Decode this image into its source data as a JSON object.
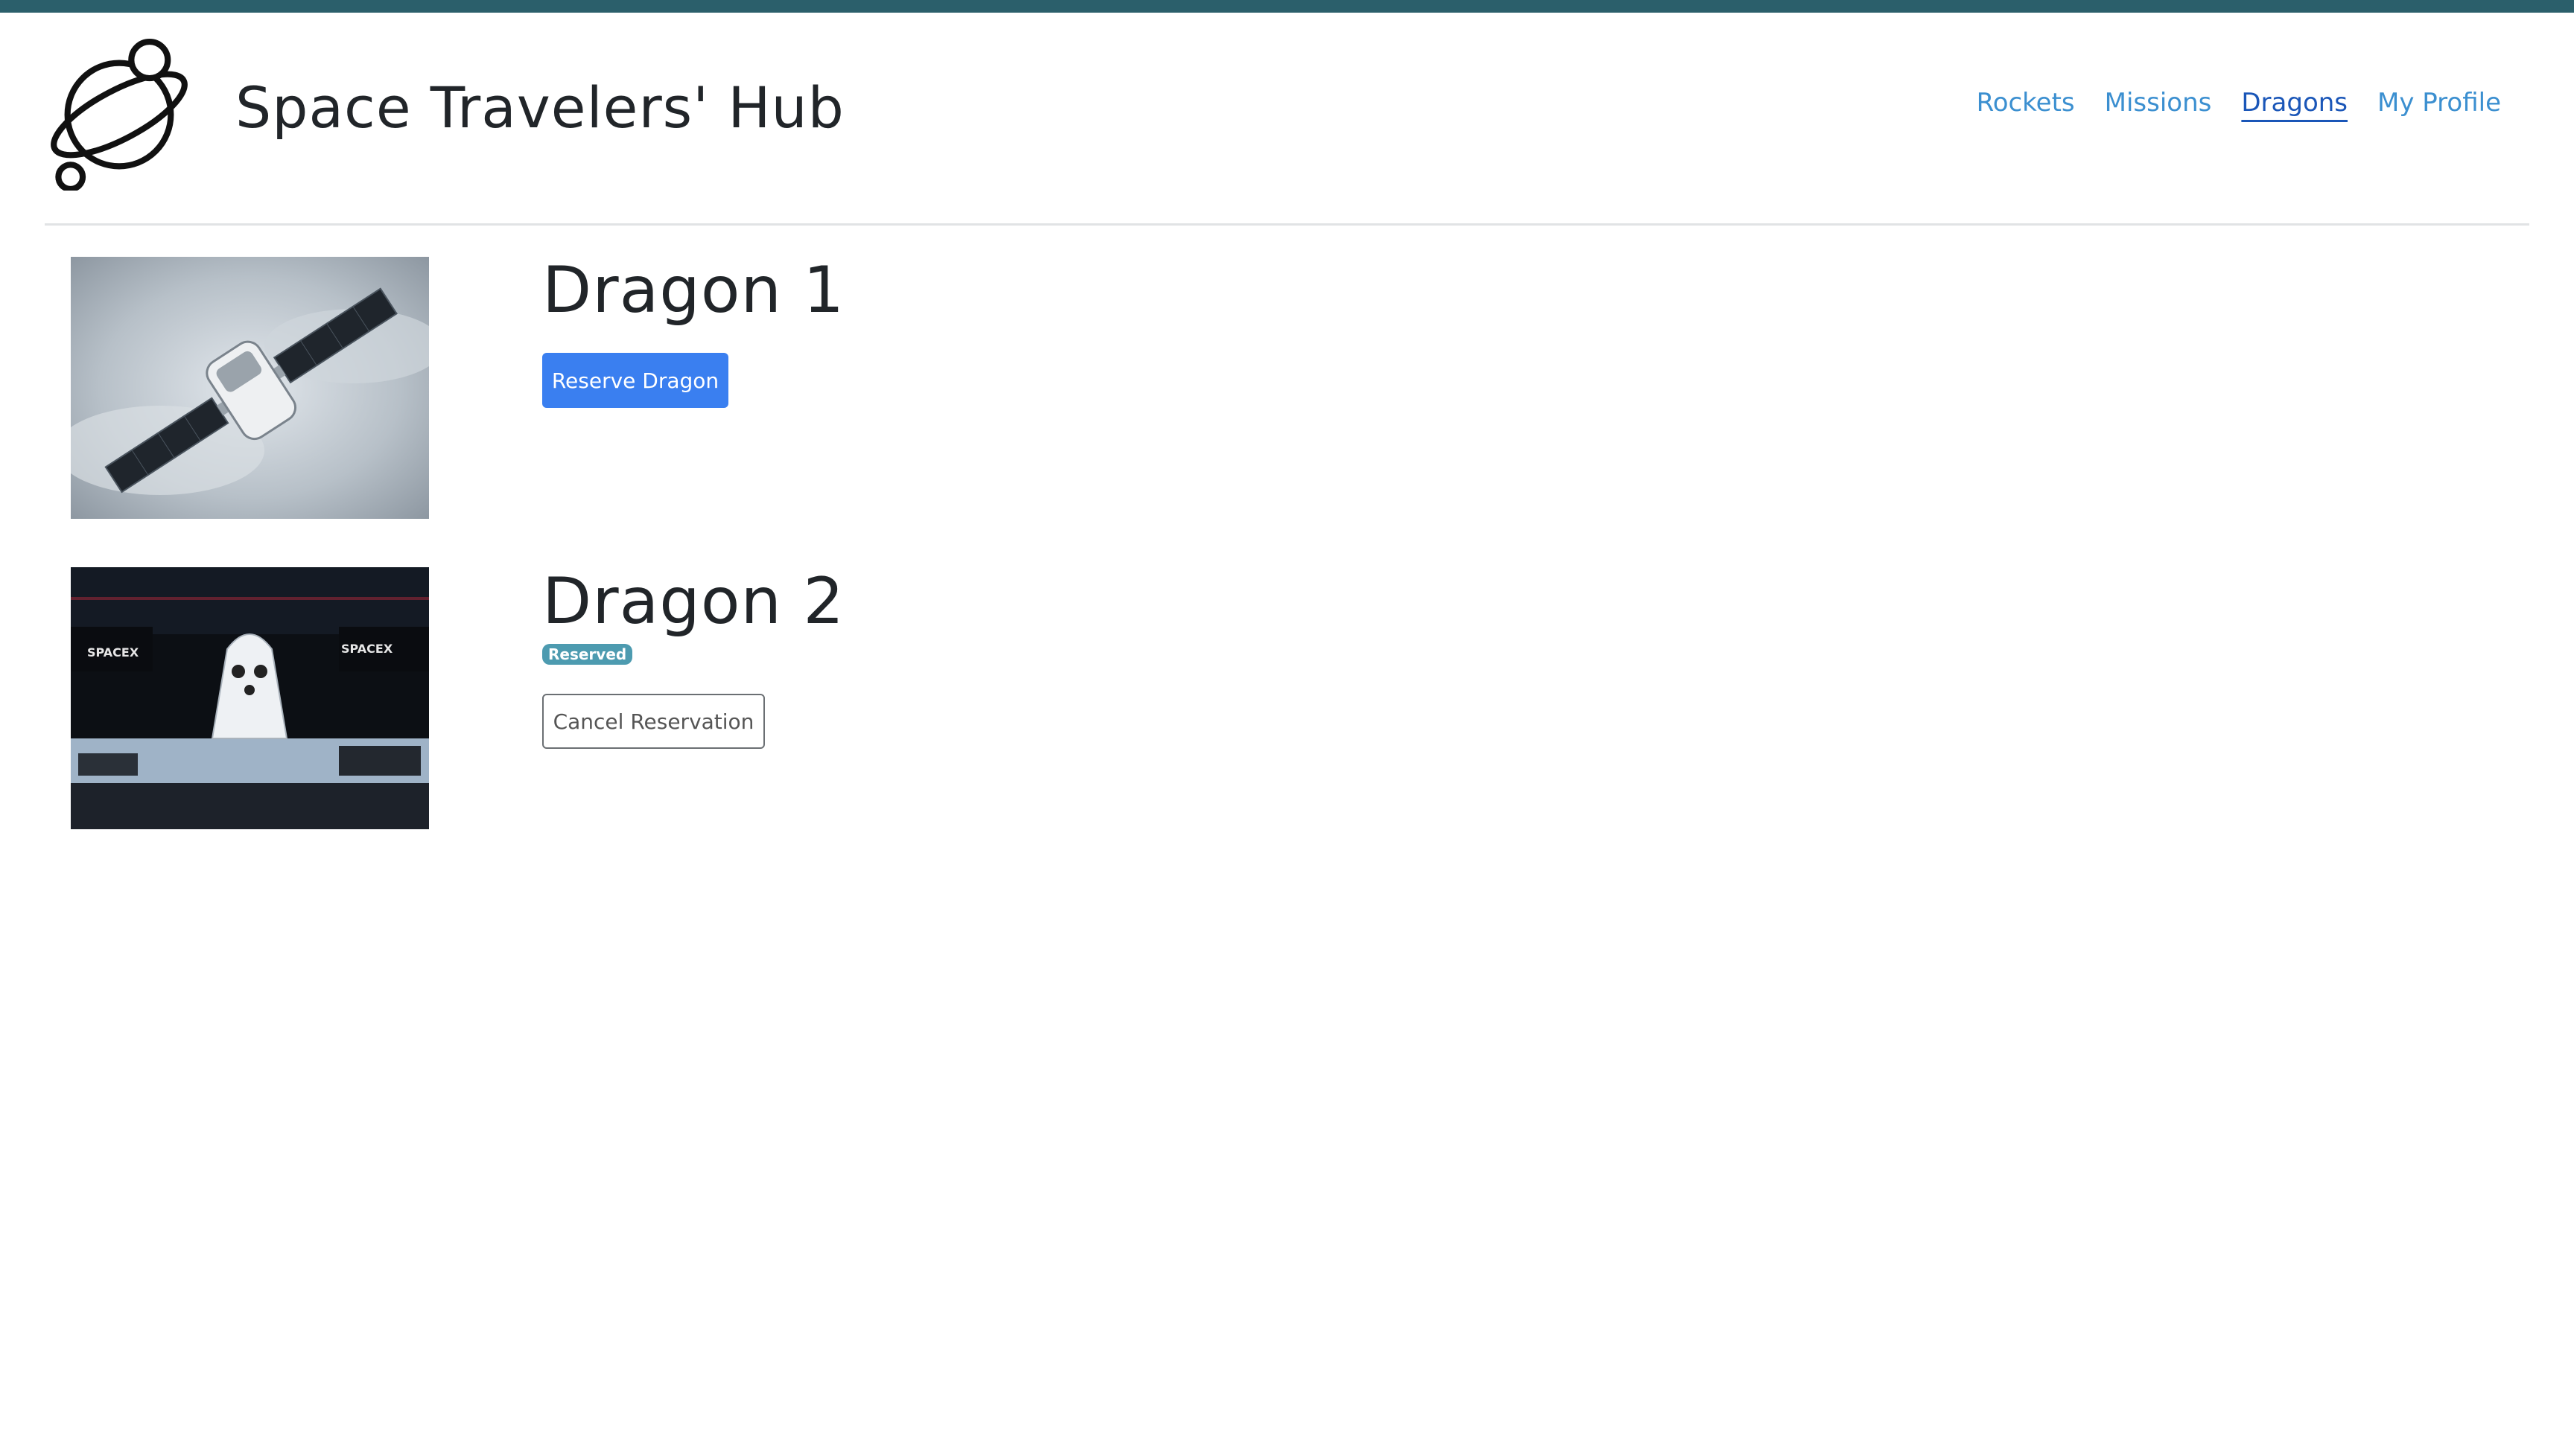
{
  "app": {
    "title": "Space Travelers' Hub",
    "logo_icon": "planet-logo-icon"
  },
  "nav": {
    "items": [
      {
        "label": "Rockets",
        "active": false
      },
      {
        "label": "Missions",
        "active": false
      },
      {
        "label": "Dragons",
        "active": true
      },
      {
        "label": "My Profile",
        "active": false
      }
    ]
  },
  "dragons": [
    {
      "name": "Dragon 1",
      "reserved": false,
      "action_label": "Reserve Dragon",
      "image": "dragon-capsule-orbit-image"
    },
    {
      "name": "Dragon 2",
      "reserved": true,
      "badge_label": "Reserved",
      "action_label": "Cancel Reservation",
      "image": "dragon-capsule-hangar-image"
    }
  ],
  "colors": {
    "topbar": "#2b5f6b",
    "nav_link": "#3b8fd0",
    "nav_active": "#1a56b8",
    "primary_button": "#3a7ff0",
    "badge": "#4d9bb0"
  }
}
